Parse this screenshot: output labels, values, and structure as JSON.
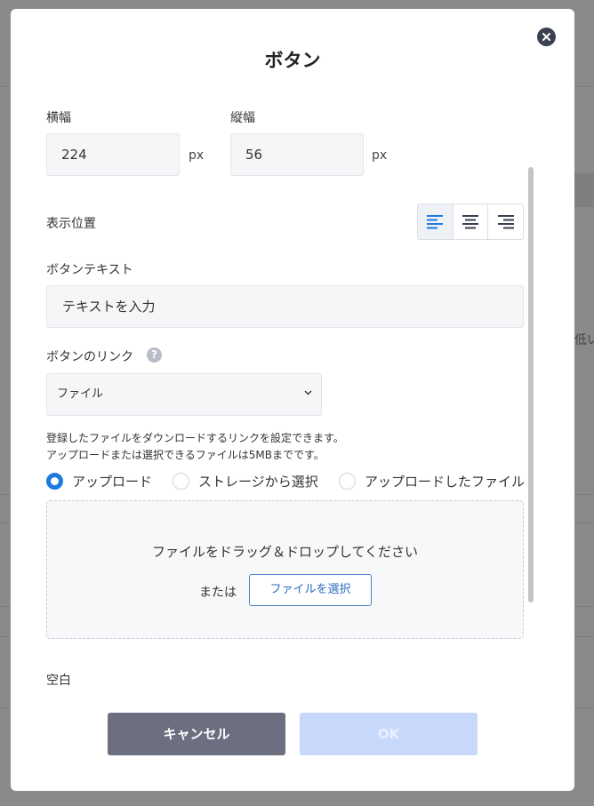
{
  "background": {
    "fragment_text": "低い"
  },
  "modal": {
    "title": "ボタン",
    "close_icon": "close-icon"
  },
  "size": {
    "width_label": "横幅",
    "width_value": "224",
    "width_unit": "px",
    "height_label": "縦幅",
    "height_value": "56",
    "height_unit": "px"
  },
  "position": {
    "label": "表示位置",
    "options": [
      "align-left-icon",
      "align-center-icon",
      "align-right-icon"
    ],
    "selected": "align-left"
  },
  "button_text": {
    "label": "ボタンテキスト",
    "placeholder": "テキストを入力"
  },
  "link": {
    "label": "ボタンのリンク",
    "help_icon": "help-icon",
    "selected": "ファイル",
    "description_line1": "登録したファイルをダウンロードするリンクを設定できます。",
    "description_line2": "アップロードまたは選択できるファイルは5MBまでです。"
  },
  "source": {
    "options": [
      "アップロード",
      "ストレージから選択",
      "アップロードしたファイル"
    ],
    "selected_index": 0
  },
  "dropzone": {
    "text": "ファイルをドラッグ＆ドロップしてください",
    "or_text": "または",
    "button_label": "ファイルを選択"
  },
  "spacing": {
    "label": "空白"
  },
  "footer": {
    "cancel_label": "キャンセル",
    "ok_label": "OK"
  },
  "colors": {
    "accent": "#1f7ae0",
    "cancel_bg": "#6b6f80",
    "ok_bg_disabled": "#c7d8fb"
  }
}
